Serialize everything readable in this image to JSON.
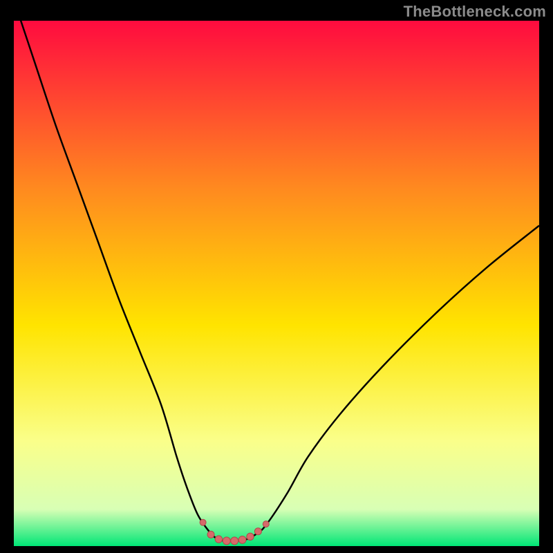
{
  "watermark": "TheBottleneck.com",
  "colors": {
    "gradient_top": "#ff0b3f",
    "gradient_mid1": "#ff8a1f",
    "gradient_mid2": "#ffe400",
    "gradient_mid3": "#faff8a",
    "gradient_mid4": "#d8ffb5",
    "gradient_bottom": "#00e676",
    "curve": "#000000",
    "marker_fill": "#d66a6a",
    "marker_stroke": "#b04a4a",
    "frame": "#000000"
  },
  "chart_data": {
    "type": "line",
    "title": "",
    "xlabel": "",
    "ylabel": "",
    "xlim": [
      0,
      100
    ],
    "ylim": [
      0,
      100
    ],
    "grid": false,
    "series": [
      {
        "name": "bottleneck-curve",
        "x": [
          0,
          4,
          8,
          12,
          16,
          20,
          24,
          28,
          31,
          33,
          35,
          37,
          38.5,
          40,
          42,
          44,
          46,
          48,
          52,
          56,
          62,
          70,
          80,
          90,
          100
        ],
        "y": [
          104,
          92,
          80,
          69,
          58,
          47,
          37,
          27,
          17,
          11,
          6,
          3,
          1.5,
          1,
          1,
          1.2,
          2.2,
          4,
          10,
          17,
          25,
          34,
          44,
          53,
          61
        ]
      }
    ],
    "markers": {
      "name": "valley-markers",
      "x": [
        36,
        37.5,
        39,
        40.5,
        42,
        43.5,
        45,
        46.5,
        48
      ],
      "y": [
        4.5,
        2.2,
        1.3,
        1.0,
        1.0,
        1.2,
        1.8,
        2.8,
        4.2
      ],
      "r": [
        4.5,
        5.0,
        5.2,
        5.5,
        5.5,
        5.4,
        5.2,
        5.0,
        4.5
      ]
    }
  }
}
